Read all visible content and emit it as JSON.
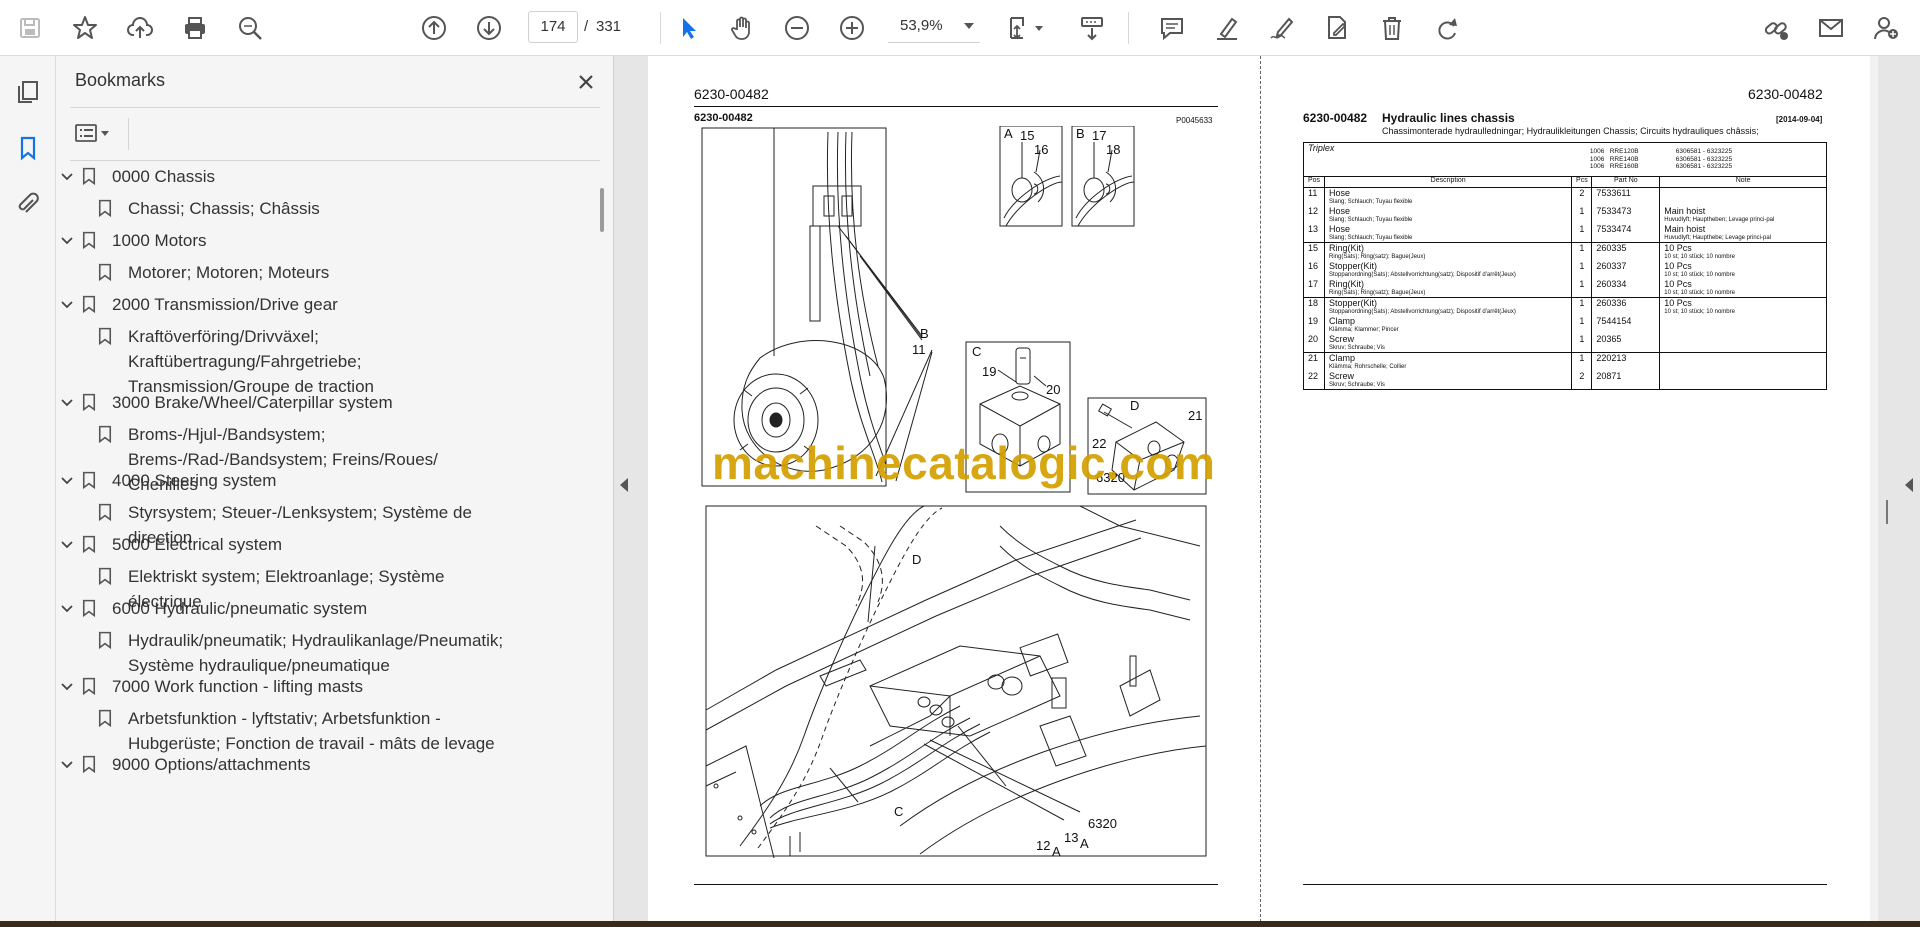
{
  "toolbar": {
    "page_current": "174",
    "page_separator": "/",
    "page_total": "331",
    "zoom": "53,9%"
  },
  "panel": {
    "title": "Bookmarks"
  },
  "bookmarks": [
    {
      "label": "0000 Chassis"
    },
    {
      "label": "Chassi; Chassis; Châssis"
    },
    {
      "label": "1000 Motors"
    },
    {
      "label": "Motorer; Motoren; Moteurs"
    },
    {
      "label": "2000 Transmission/Drive gear"
    },
    {
      "label": "Kraftöverföring/Drivväxel; Kraftübertragung/Fahrgetriebe; Transmission/Groupe de traction"
    },
    {
      "label": "3000 Brake/Wheel/Caterpillar system"
    },
    {
      "label": "Broms-/Hjul-/Bandsystem; Brems-/Rad-/Bandsystem; Freins/Roues/ Chenilles"
    },
    {
      "label": "4000 Steering system"
    },
    {
      "label": "Styrsystem; Steuer-/Lenksystem; Système de direction"
    },
    {
      "label": "5000 Electrical system"
    },
    {
      "label": "Elektriskt system; Elektroanlage; Système électrique"
    },
    {
      "label": "6000 Hydraulic/pneumatic system"
    },
    {
      "label": "Hydraulik/pneumatik; Hydraulikanlage/Pneumatik; Système hydraulique/pneumatique"
    },
    {
      "label": "7000 Work function - lifting masts"
    },
    {
      "label": "Arbetsfunktion - lyftstativ; Arbetsfunktion - Hubgerüste; Fonction de travail - mâts de levage"
    },
    {
      "label": "9000 Options/attachments"
    }
  ],
  "left_page": {
    "header": "6230-00482",
    "code": "6230-00482",
    "picture_code": "P0045633",
    "labels": {
      "a": "A",
      "b": "B",
      "c": "C",
      "d": "D",
      "n15": "15",
      "n16": "16",
      "n17": "17",
      "n18": "18",
      "n19": "19",
      "n20": "20",
      "n21": "21",
      "n22": "22",
      "n11": "11",
      "n12": "12",
      "n13": "13",
      "n6320": "6320",
      "n6320b": "6320",
      "b_main": "B",
      "d_main": "D",
      "c_main": "C",
      "a12": "A",
      "a13": "A"
    }
  },
  "watermark": "machinecatalogic.com",
  "right_page": {
    "header": "6230-00482",
    "code": "6230-00482",
    "title": "Hydraulic lines chassis",
    "date": "[2014-09-04]",
    "subtitle": "Chassimonterade hydraulledningar; Hydraulikleitungen Chassis; Circuits hydrauliques châssis;",
    "triplex": "Triplex",
    "models": "1006   RRE120B\n1006   RRE140B\n1006   RRE160B",
    "serials": "6306581 - 6323225\n6306581 - 6323225\n6306581 - 6323225",
    "columns": [
      "Pos",
      "Description",
      "Pcs",
      "Part No",
      "Note"
    ],
    "rows": [
      {
        "pos": "11",
        "desc": "Hose",
        "desc_sub": "Slang; Schlauch; Tuyau flexible",
        "pcs": "2",
        "part": "7533611",
        "note": "",
        "note_sub": "",
        "group_start": true
      },
      {
        "pos": "12",
        "desc": "Hose",
        "desc_sub": "Slang; Schlauch; Tuyau flexible",
        "pcs": "1",
        "part": "7533473",
        "note": "Main hoist",
        "note_sub": "Huvudlyft; Hauptheben; Levage princi-pal",
        "group_start": false
      },
      {
        "pos": "13",
        "desc": "Hose",
        "desc_sub": "Slang; Schlauch; Tuyau flexible",
        "pcs": "1",
        "part": "7533474",
        "note": "Main hoist",
        "note_sub": "Huvudlyft; Haupthebe; Levage princi-pal",
        "group_start": false
      },
      {
        "pos": "15",
        "desc": "Ring(Kit)",
        "desc_sub": "Ring(Sats); Ring(satz); Bague(Jeux)",
        "pcs": "1",
        "part": "260335",
        "note": "10 Pcs",
        "note_sub": "10 st; 10 stück; 10 nombre",
        "group_start": true
      },
      {
        "pos": "16",
        "desc": "Stopper(Kit)",
        "desc_sub": "Stoppanordning(Sats); Abstellvorrichtung(satz); Dispositif d'arrêt(Jeux)",
        "pcs": "1",
        "part": "260337",
        "note": "10 Pcs",
        "note_sub": "10 st; 10 stück; 10 nombre",
        "group_start": false
      },
      {
        "pos": "17",
        "desc": "Ring(Kit)",
        "desc_sub": "Ring(Sats); Ring(satz); Bague(Jeux)",
        "pcs": "1",
        "part": "260334",
        "note": "10 Pcs",
        "note_sub": "10 st; 10 stück; 10 nombre",
        "group_start": false
      },
      {
        "pos": "18",
        "desc": "Stopper(Kit)",
        "desc_sub": "Stoppanordning(Sats); Abstellvorrichtung(satz); Dispositif d'arrêt(Jeux)",
        "pcs": "1",
        "part": "260336",
        "note": "10 Pcs",
        "note_sub": "10 st; 10 stück; 10 nombre",
        "group_start": true
      },
      {
        "pos": "19",
        "desc": "Clamp",
        "desc_sub": "Klämma; Klammer; Pincer",
        "pcs": "1",
        "part": "7544154",
        "note": "",
        "note_sub": "",
        "group_start": false
      },
      {
        "pos": "20",
        "desc": "Screw",
        "desc_sub": "Skruv; Schraube; Vis",
        "pcs": "1",
        "part": "20365",
        "note": "",
        "note_sub": "",
        "group_start": false
      },
      {
        "pos": "21",
        "desc": "Clamp",
        "desc_sub": "Klämma; Rohrschelle; Collier",
        "pcs": "1",
        "part": "220213",
        "note": "",
        "note_sub": "",
        "group_start": true
      },
      {
        "pos": "22",
        "desc": "Screw",
        "desc_sub": "Skruv; Schraube; Vis",
        "pcs": "2",
        "part": "20871",
        "note": "",
        "note_sub": "",
        "group_start": false
      }
    ]
  }
}
